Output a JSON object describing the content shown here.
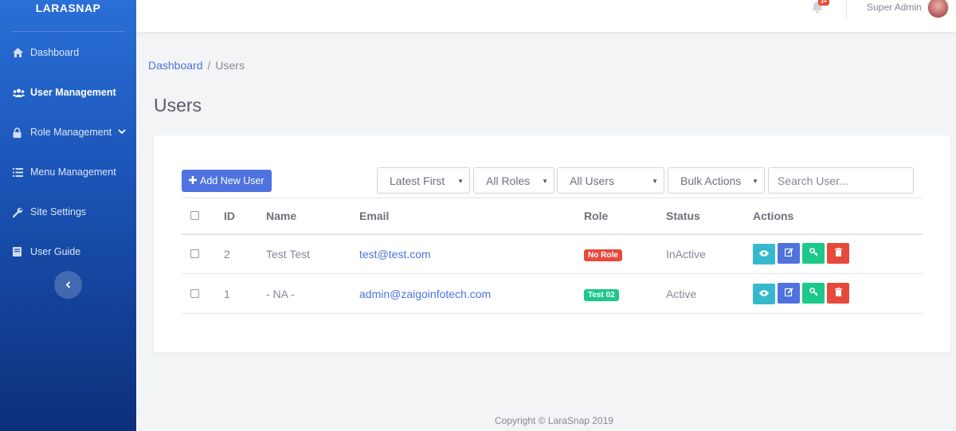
{
  "brand": "LARASNAP",
  "sidebar": {
    "items": [
      {
        "label": "Dashboard",
        "icon": "home-icon"
      },
      {
        "label": "User Management",
        "icon": "users-icon",
        "active": true
      },
      {
        "label": "Role Management",
        "icon": "lock-icon"
      },
      {
        "label": "Menu Management",
        "icon": "list-icon"
      },
      {
        "label": "Site Settings",
        "icon": "wrench-icon"
      },
      {
        "label": "User Guide",
        "icon": "book-icon"
      }
    ],
    "toggle_icon": "chevron-left-icon"
  },
  "topbar": {
    "notification_count": "3+",
    "user_name": "Super Admin"
  },
  "breadcrumb": {
    "home": "Dashboard",
    "separator": "/",
    "current": "Users"
  },
  "page_title": "Users",
  "toolbar": {
    "add_label": "Add New User",
    "sort_value": "Latest First",
    "role_filter_value": "All Roles",
    "status_filter_value": "All Users",
    "bulk_value": "Bulk Actions",
    "search_placeholder": "Search User..."
  },
  "table": {
    "headers": [
      "ID",
      "Name",
      "Email",
      "Role",
      "Status",
      "Actions"
    ],
    "rows": [
      {
        "id": "2",
        "name": "Test Test",
        "email": "test@test.com",
        "role": "No Role",
        "role_color": "#e74a3b",
        "status": "InActive"
      },
      {
        "id": "1",
        "name": "- NA -",
        "email": "admin@zaigoinfotech.com",
        "role": "Test 02",
        "role_color": "#1cc88a",
        "status": "Active"
      }
    ]
  },
  "action_colors": {
    "view": "#36b9cc",
    "edit": "#4e73df",
    "permissions": "#1cc88a",
    "delete": "#e74a3b"
  },
  "footer": "Copyright © LaraSnap 2019"
}
